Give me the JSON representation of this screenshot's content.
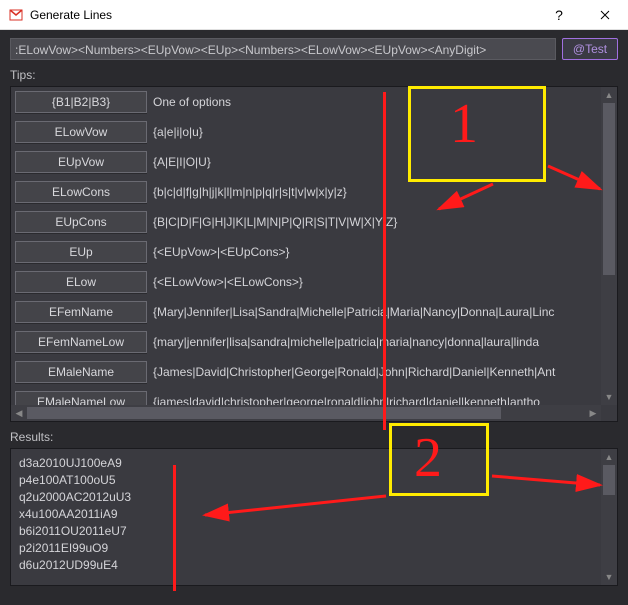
{
  "window": {
    "title": "Generate Lines"
  },
  "input": {
    "pattern": ":ELowVow><Numbers><EUpVow><EUp><Numbers><ELowVow><EUpVow><AnyDigit>"
  },
  "buttons": {
    "test": "@Test"
  },
  "labels": {
    "tips": "Tips:",
    "results": "Results:"
  },
  "tips": [
    {
      "tag": "{B1|B2|B3}",
      "val": "One of options"
    },
    {
      "tag": "ELowVow",
      "val": "{a|e|i|o|u}"
    },
    {
      "tag": "EUpVow",
      "val": "{A|E|I|O|U}"
    },
    {
      "tag": "ELowCons",
      "val": "{b|c|d|f|g|h|j|k|l|m|n|p|q|r|s|t|v|w|x|y|z}"
    },
    {
      "tag": "EUpCons",
      "val": "{B|C|D|F|G|H|J|K|L|M|N|P|Q|R|S|T|V|W|X|Y|Z}"
    },
    {
      "tag": "EUp",
      "val": "{<EUpVow>|<EUpCons>}"
    },
    {
      "tag": "ELow",
      "val": "{<ELowVow>|<ELowCons>}"
    },
    {
      "tag": "EFemName",
      "val": "{Mary|Jennifer|Lisa|Sandra|Michelle|Patricia|Maria|Nancy|Donna|Laura|Linc"
    },
    {
      "tag": "EFemNameLow",
      "val": "{mary|jennifer|lisa|sandra|michelle|patricia|maria|nancy|donna|laura|linda"
    },
    {
      "tag": "EMaleName",
      "val": "{James|David|Christopher|George|Ronald|John|Richard|Daniel|Kenneth|Ant"
    },
    {
      "tag": "EMaleNameLow",
      "val": "{james|david|christopher|george|ronald|john|richard|daniel|kenneth|antho"
    }
  ],
  "results": [
    "d3a2010UJ100eA9",
    "p4e100AT100oU5",
    "q2u2000AC2012uU3",
    "x4u100AA2011iA9",
    "b6i2011OU2011eU7",
    "p2i2011EI99uO9",
    "d6u2012UD99uE4"
  ],
  "annotations": {
    "num1": "1",
    "num2": "2"
  }
}
